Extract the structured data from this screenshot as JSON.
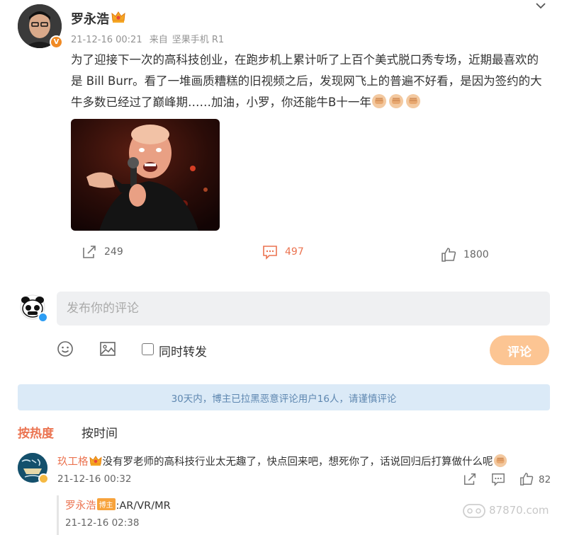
{
  "post": {
    "author": "罗永浩",
    "date": "21-12-16 00:21",
    "source_prefix": "来自",
    "source": "坚果手机 R1",
    "text": "为了迎接下一次的高科技创业，在跑步机上累计听了上百个美式脱口秀专场，近期最喜欢的是 Bill Burr。看了一堆画质糟糕的旧视频之后，发现网飞上的普遍不好看，是因为签约的大牛多数已经过了巅峰期……加油，小罗，你还能牛B十一年",
    "avatar_badge": "V"
  },
  "actions": {
    "repost_count": "249",
    "comment_count": "497",
    "like_count": "1800"
  },
  "composer": {
    "placeholder": "发布你的评论",
    "repost_label": "同时转发",
    "submit_label": "评论"
  },
  "notice": "30天内，博主已拉黑恶意评论用户16人，请谨慎评论",
  "sort": {
    "hot": "按热度",
    "time": "按时间"
  },
  "comment": {
    "author": "玖工格",
    "text": "没有罗老师的高科技行业太无趣了，快点回来吧，想死你了，话说回归后打算做什么呢",
    "time": "21-12-16 00:32",
    "likes": "82",
    "reply": {
      "author": "罗永浩",
      "badge": "博主",
      "text": ":AR/VR/MR",
      "time": "21-12-16 02:38"
    }
  },
  "watermark": "87870.com",
  "colors": {
    "accent": "#eb7350",
    "notice_bg": "#dbeaf7",
    "notice_text": "#5e87b0",
    "submit_bg": "#fcc593"
  },
  "icons": [
    "chevron-down-icon",
    "crown-icon",
    "fist-emoji-icon",
    "share-icon",
    "comment-icon",
    "like-icon",
    "emoji-icon",
    "image-icon"
  ]
}
